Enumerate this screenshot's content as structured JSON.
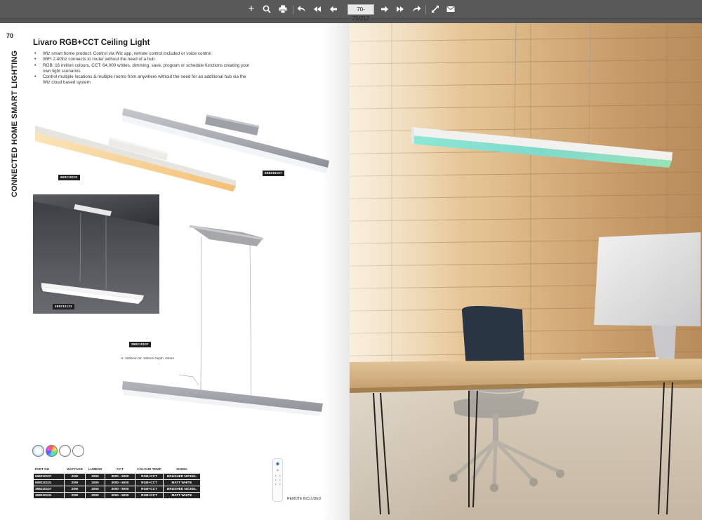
{
  "toolbar": {
    "page_indicator": "70-71/212",
    "buttons": [
      {
        "name": "zoom-in",
        "icon": "plus-icon",
        "glyph": "+"
      },
      {
        "name": "search",
        "icon": "search-icon"
      },
      {
        "name": "print",
        "icon": "print-icon"
      },
      {
        "name": "first-page",
        "icon": "first-page-icon"
      },
      {
        "name": "prev-fast",
        "icon": "fast-back-icon"
      },
      {
        "name": "prev-page",
        "icon": "arrow-left-icon"
      },
      {
        "name": "next-page",
        "icon": "arrow-right-icon"
      },
      {
        "name": "next-fast",
        "icon": "fast-forward-icon"
      },
      {
        "name": "last-page",
        "icon": "last-page-icon"
      },
      {
        "name": "fullscreen",
        "icon": "fullscreen-icon"
      },
      {
        "name": "email",
        "icon": "email-icon"
      }
    ],
    "colors": {
      "bar": "#595959",
      "icon": "#ffffff"
    }
  },
  "page_left": {
    "page_number": "70",
    "side_title": "CONNECTED HOME SMART LIGHTING",
    "product_title": "Livaro RGB+CCT Ceiling Light",
    "features": [
      "Wiz smart home product. Control via Wiz app, remote control included or voice control",
      "WiFi 2.4Ghz connects to router without the need of a hub",
      "RGB: 16 million colours, CCT: 64,000 whites, dimming, save, program or schedule functions creating your own light scenarios",
      "Control multiple locations & multiple rooms from anywhere without the need for an additional hub via the Wiz cloud based system"
    ],
    "image_codes": {
      "ceiling_white": "658210131",
      "ceiling_nickel": "658210107",
      "pendant_photo": "358210131",
      "pendant_nickel": "358210107"
    },
    "dimensions_note": "H: 1500mm  W: 100mm  Depth: 63mm",
    "feature_icons": [
      "wiz-icon",
      "rgb-colour-icon",
      "dimmable-icon",
      "remote-icon"
    ],
    "specs": {
      "headers": [
        "PART NO",
        "WATTAGE",
        "LUMENS",
        "CCT",
        "COLOUR TEMP",
        "FINISH"
      ],
      "rows": [
        [
          "658210107",
          "20W",
          "2000",
          "3000 - 5000",
          "RGB+CCT",
          "BRUSHED NICKEL"
        ],
        [
          "658210131",
          "20W",
          "2000",
          "3000 - 5000",
          "RGB+CCT",
          "MATT WHITE"
        ],
        [
          "358210107",
          "20W",
          "2000",
          "3000 - 5000",
          "RGB+CCT",
          "BRUSHED NICKEL"
        ],
        [
          "358210131",
          "20W",
          "2000",
          "3000 - 5000",
          "RGB+CCT",
          "MATT WHITE"
        ]
      ]
    },
    "remote_label": "REMOTE INCLUDED"
  },
  "page_right": {
    "scene": "office-wood-wall-photo",
    "colors": {
      "wood_light": "#e9cfa4",
      "wood_dark": "#b48d62",
      "floor": "#cfc6b8",
      "glow": "#7fe3cf"
    }
  }
}
